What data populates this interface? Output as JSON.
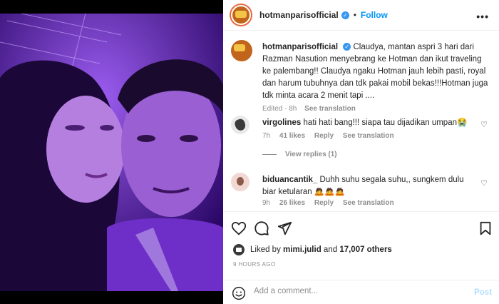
{
  "post": {
    "username": "hotmanparisofficial",
    "follow_label": "Follow",
    "more_label": "•••"
  },
  "caption": {
    "username": "hotmanparisofficial",
    "text": "Claudya, mantan aspri 3 hari dari Razman Nasution menyebrang ke Hotman dan ikut traveling ke palembang!! Claudya ngaku Hotman jauh lebih pasti, royal dan harum tubuhnya dan tdk pakai mobil bekas!!!Hotman juga tdk minta acara 2 menit tapi ....",
    "edited": "Edited · 8h",
    "see_translation": "See translation"
  },
  "comments": [
    {
      "username": "virgolines",
      "text": "hati hati bang!!! siapa tau dijadikan umpan😭",
      "time": "7h",
      "likes": "41 likes",
      "reply": "Reply",
      "see_translation": "See translation",
      "view_replies": "View replies (1)"
    },
    {
      "username": "biduancantik_",
      "text": "Duhh suhu segala suhu,, sungkem dulu biar ketularan 🙇🙇🙇",
      "time": "9h",
      "likes": "26 likes",
      "reply": "Reply",
      "see_translation": "See translation"
    }
  ],
  "likes": {
    "prefix": "Liked by",
    "user": "mimi.julid",
    "connector": "and",
    "others": "17,007 others"
  },
  "time_ago": "9 HOURS AGO",
  "add_comment": {
    "placeholder": "Add a comment...",
    "post_label": "Post"
  },
  "icons": {
    "like": "heart-icon",
    "comment": "comment-icon",
    "share": "share-icon",
    "save": "bookmark-icon",
    "emoji": "emoji-icon"
  },
  "colors": {
    "link_blue": "#0095f6",
    "post_disabled": "#b2dffc",
    "muted": "#8e8e8e"
  }
}
